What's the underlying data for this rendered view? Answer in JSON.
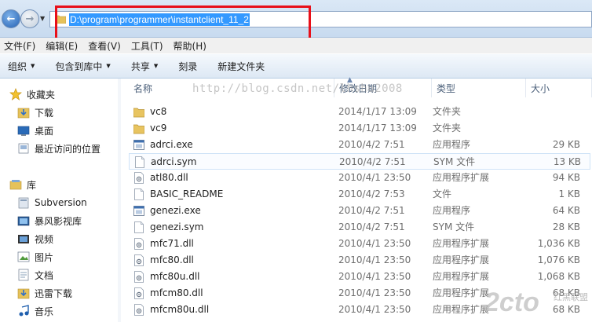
{
  "address": {
    "path": "D:\\program\\programmer\\instantclient_11_2",
    "back_icon": "back-arrow-icon",
    "forward_icon": "forward-arrow-icon"
  },
  "menu": [
    "文件(F)",
    "编辑(E)",
    "查看(V)",
    "工具(T)",
    "帮助(H)"
  ],
  "toolbar": {
    "organize": "组织",
    "include_in_library": "包含到库中",
    "share": "共享",
    "burn": "刻录",
    "new_folder": "新建文件夹"
  },
  "nav": {
    "favorites": "收藏夹",
    "downloads": "下载",
    "desktop": "桌面",
    "recent": "最近访问的位置",
    "libraries": "库",
    "subversion": "Subversion",
    "video_player": "暴风影视库",
    "videos": "视频",
    "pictures": "图片",
    "documents": "文档",
    "thunder": "迅雷下载",
    "music": "音乐"
  },
  "columns": {
    "name": "名称",
    "date": "修改日期",
    "type": "类型",
    "size": "大小"
  },
  "files": [
    {
      "name": "vc8",
      "date": "2014/1/17 13:09",
      "type": "文件夹",
      "size": "",
      "icon": "folder-icon"
    },
    {
      "name": "vc9",
      "date": "2014/1/17 13:09",
      "type": "文件夹",
      "size": "",
      "icon": "folder-icon"
    },
    {
      "name": "adrci.exe",
      "date": "2010/4/2 7:51",
      "type": "应用程序",
      "size": "29 KB",
      "icon": "exe-icon"
    },
    {
      "name": "adrci.sym",
      "date": "2010/4/2 7:51",
      "type": "SYM 文件",
      "size": "13 KB",
      "icon": "file-icon"
    },
    {
      "name": "atl80.dll",
      "date": "2010/4/1 23:50",
      "type": "应用程序扩展",
      "size": "94 KB",
      "icon": "dll-icon"
    },
    {
      "name": "BASIC_README",
      "date": "2010/4/2 7:53",
      "type": "文件",
      "size": "1 KB",
      "icon": "file-icon"
    },
    {
      "name": "genezi.exe",
      "date": "2010/4/2 7:51",
      "type": "应用程序",
      "size": "64 KB",
      "icon": "exe-icon"
    },
    {
      "name": "genezi.sym",
      "date": "2010/4/2 7:51",
      "type": "SYM 文件",
      "size": "28 KB",
      "icon": "file-icon"
    },
    {
      "name": "mfc71.dll",
      "date": "2010/4/1 23:50",
      "type": "应用程序扩展",
      "size": "1,036 KB",
      "icon": "dll-icon"
    },
    {
      "name": "mfc80.dll",
      "date": "2010/4/1 23:50",
      "type": "应用程序扩展",
      "size": "1,076 KB",
      "icon": "dll-icon"
    },
    {
      "name": "mfc80u.dll",
      "date": "2010/4/1 23:50",
      "type": "应用程序扩展",
      "size": "1,068 KB",
      "icon": "dll-icon"
    },
    {
      "name": "mfcm80.dll",
      "date": "2010/4/1 23:50",
      "type": "应用程序扩展",
      "size": "68 KB",
      "icon": "dll-icon"
    },
    {
      "name": "mfcm80u.dll",
      "date": "2010/4/1 23:50",
      "type": "应用程序扩展",
      "size": "68 KB",
      "icon": "dll-icon"
    }
  ],
  "watermark": "http://blog.csdn.net/lhshu2008",
  "logo": "2cto",
  "logo_sub": "红黑联盟"
}
